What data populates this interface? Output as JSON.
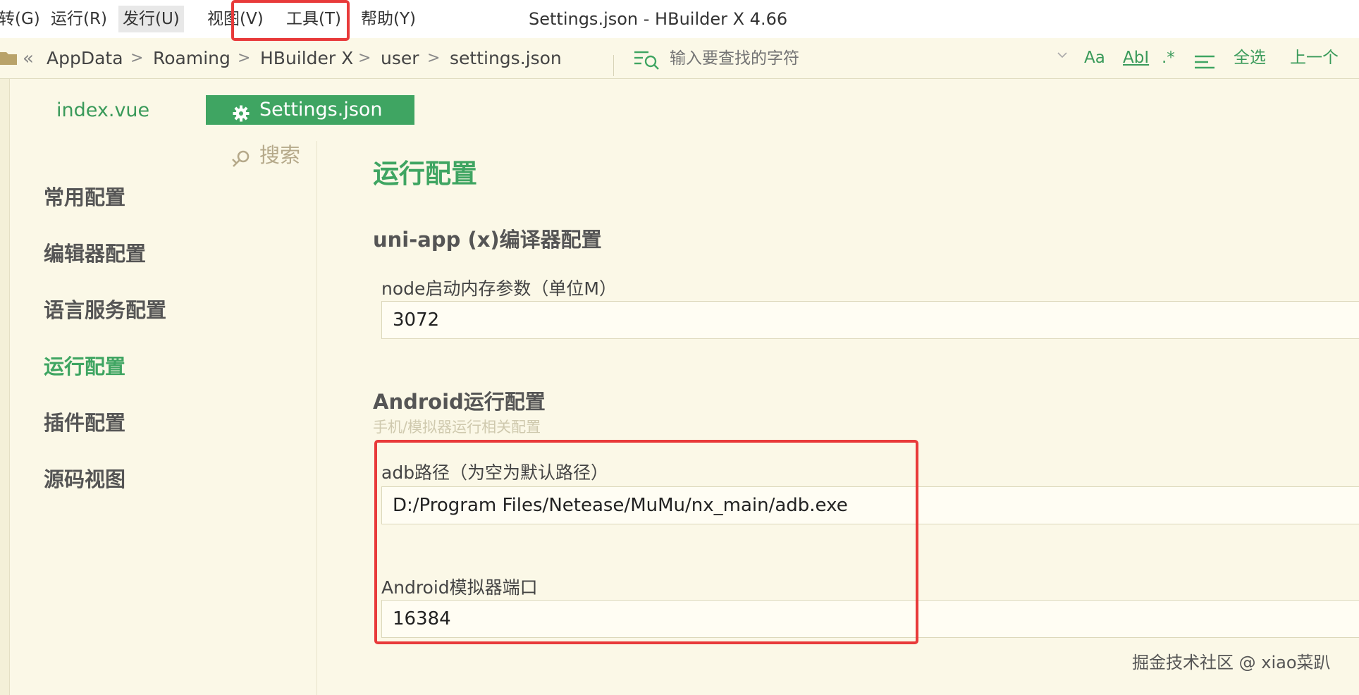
{
  "menu": {
    "items": [
      "转(G)",
      "运行(R)",
      "发行(U)",
      "视图(V)",
      "工具(T)",
      "帮助(Y)"
    ]
  },
  "window": {
    "title": "Settings.json - HBuilder X 4.66"
  },
  "breadcrumb": {
    "back": "«",
    "items": [
      "AppData",
      "Roaming",
      "HBuilder X",
      "user",
      "settings.json"
    ],
    "separator": ">"
  },
  "find_bar": {
    "placeholder": "输入要查找的字符",
    "options": [
      "Aa",
      "AbI",
      ".*",
      "全选",
      "上一个"
    ]
  },
  "tabs": [
    {
      "label": "index.vue",
      "active": false
    },
    {
      "label": "Settings.json",
      "active": true
    }
  ],
  "sidebar": {
    "search_label": "搜索",
    "items": [
      {
        "label": "常用配置",
        "active": false
      },
      {
        "label": "编辑器配置",
        "active": false
      },
      {
        "label": "语言服务配置",
        "active": false
      },
      {
        "label": "运行配置",
        "active": true
      },
      {
        "label": "插件配置",
        "active": false
      },
      {
        "label": "源码视图",
        "active": false
      }
    ]
  },
  "main": {
    "title": "运行配置",
    "sections": [
      {
        "title": "uni-app (x)编译器配置",
        "fields": [
          {
            "label": "node启动内存参数（单位M）",
            "value": "3072"
          }
        ]
      },
      {
        "title": "Android运行配置",
        "subtitle": "手机/模拟器运行相关配置",
        "fields": [
          {
            "label": "adb路径（为空为默认路径）",
            "value": "D:/Program Files/Netease/MuMu/nx_main/adb.exe"
          },
          {
            "label": "Android模拟器端口",
            "value": "16384"
          }
        ]
      }
    ]
  },
  "watermark": "掘金技术社区 @ xiao菜趴",
  "colors": {
    "accent": "#3fa562",
    "background": "#fbf8e7",
    "annotation": "#e83a3a"
  }
}
